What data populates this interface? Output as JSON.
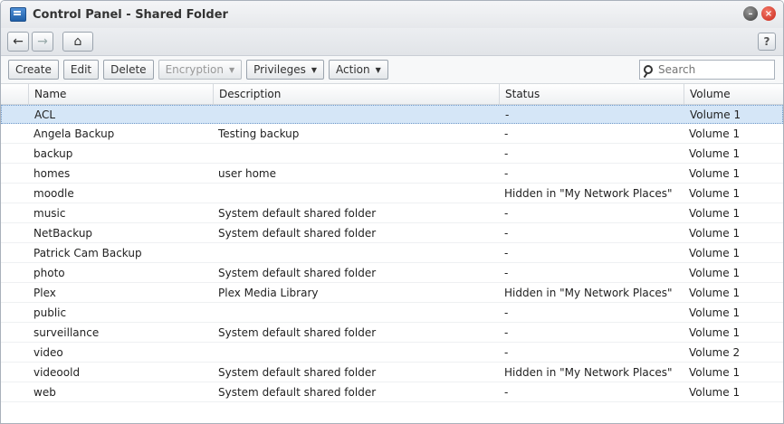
{
  "window": {
    "title": "Control Panel - Shared Folder"
  },
  "nav": {
    "back": "←",
    "forward": "→",
    "home": "⌂",
    "help": "?"
  },
  "toolbar": {
    "create": "Create",
    "edit": "Edit",
    "delete": "Delete",
    "encryption": "Encryption",
    "privileges": "Privileges",
    "action": "Action",
    "search_placeholder": "Search"
  },
  "table": {
    "headers": [
      "Name",
      "Description",
      "Status",
      "Volume"
    ],
    "rows": [
      {
        "name": "ACL",
        "description": "",
        "status": "-",
        "volume": "Volume 1",
        "selected": true
      },
      {
        "name": "Angela Backup",
        "description": "Testing backup",
        "status": "-",
        "volume": "Volume 1"
      },
      {
        "name": "backup",
        "description": "",
        "status": "-",
        "volume": "Volume 1"
      },
      {
        "name": "homes",
        "description": "user home",
        "status": "-",
        "volume": "Volume 1"
      },
      {
        "name": "moodle",
        "description": "",
        "status": "Hidden in \"My Network Places\"",
        "volume": "Volume 1"
      },
      {
        "name": "music",
        "description": "System default shared folder",
        "status": "-",
        "volume": "Volume 1"
      },
      {
        "name": "NetBackup",
        "description": "System default shared folder",
        "status": "-",
        "volume": "Volume 1"
      },
      {
        "name": "Patrick Cam Backup",
        "description": "",
        "status": "-",
        "volume": "Volume 1"
      },
      {
        "name": "photo",
        "description": "System default shared folder",
        "status": "-",
        "volume": "Volume 1"
      },
      {
        "name": "Plex",
        "description": "Plex Media Library",
        "status": "Hidden in \"My Network Places\"",
        "volume": "Volume 1"
      },
      {
        "name": "public",
        "description": "",
        "status": "-",
        "volume": "Volume 1"
      },
      {
        "name": "surveillance",
        "description": "System default shared folder",
        "status": "-",
        "volume": "Volume 1"
      },
      {
        "name": "video",
        "description": "",
        "status": "-",
        "volume": "Volume 2"
      },
      {
        "name": "videoold",
        "description": "System default shared folder",
        "status": "Hidden in \"My Network Places\"",
        "volume": "Volume 1"
      },
      {
        "name": "web",
        "description": "System default shared folder",
        "status": "-",
        "volume": "Volume 1"
      }
    ]
  }
}
